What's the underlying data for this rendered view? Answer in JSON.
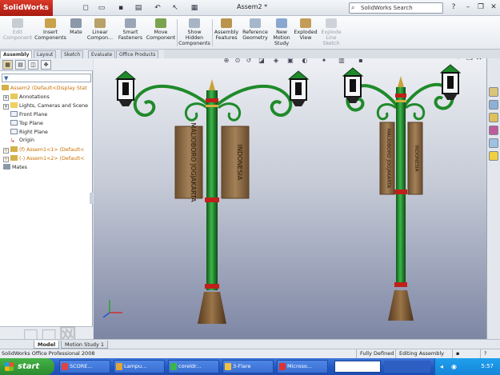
{
  "app": {
    "brand": "SolidWorks",
    "document_title": "Assem2 *",
    "search_placeholder": "SolidWorks Search"
  },
  "command_manager": {
    "buttons": [
      {
        "label": "Edit\nComponent",
        "enabled": false
      },
      {
        "label": "Insert\nComponents",
        "enabled": true
      },
      {
        "label": "Mate",
        "enabled": true
      },
      {
        "label": "Linear\nCompon...",
        "enabled": true
      },
      {
        "label": "Smart\nFasteners",
        "enabled": true
      },
      {
        "label": "Move\nComponent",
        "enabled": true
      },
      {
        "label": "Show\nHidden\nComponents",
        "enabled": true
      },
      {
        "label": "Assembly\nFeatures",
        "enabled": true
      },
      {
        "label": "Reference\nGeometry",
        "enabled": true
      },
      {
        "label": "New\nMotion\nStudy",
        "enabled": true
      },
      {
        "label": "Exploded\nView",
        "enabled": true
      },
      {
        "label": "Explode\nLine\nSketch",
        "enabled": false
      }
    ],
    "tabs": [
      "Assembly",
      "Layout",
      "Sketch",
      "Evaluate",
      "Office Products"
    ],
    "active_tab": "Assembly"
  },
  "feature_tree": {
    "items": [
      {
        "label": "Assem2  (Default<Display Stat",
        "style": "orange"
      },
      {
        "label": "Annotations",
        "style": "normal"
      },
      {
        "label": "Lights, Cameras and Scene",
        "style": "normal"
      },
      {
        "label": "Front Plane",
        "style": "normal"
      },
      {
        "label": "Top Plane",
        "style": "normal"
      },
      {
        "label": "Right Plane",
        "style": "normal"
      },
      {
        "label": "Origin",
        "style": "normal"
      },
      {
        "label": "(f) Assem1<1> (Default<",
        "style": "orange"
      },
      {
        "label": "(-) Assem1<2> (Default<",
        "style": "orange"
      },
      {
        "label": "Mates",
        "style": "normal"
      }
    ]
  },
  "viewport": {
    "banners": {
      "left_text": "MALIOBORO JOGJAKARTA",
      "right_text": "INDONESIA"
    }
  },
  "model_tabs": [
    "Model",
    "Motion Study 1"
  ],
  "status": {
    "product": "SolidWorks Office Professional 2008",
    "state": "Fully Defined",
    "mode": "Editing Assembly"
  },
  "taskbar": {
    "start": "start",
    "items": [
      "SCORE...",
      "Lampu...",
      "coreldr...",
      "3-Flare",
      "Microso..."
    ],
    "time": "5:57"
  },
  "colors": {
    "pole_green": "#1f8a2a",
    "banner_wood": "#8a6a45",
    "accent_red": "#c0201a"
  }
}
